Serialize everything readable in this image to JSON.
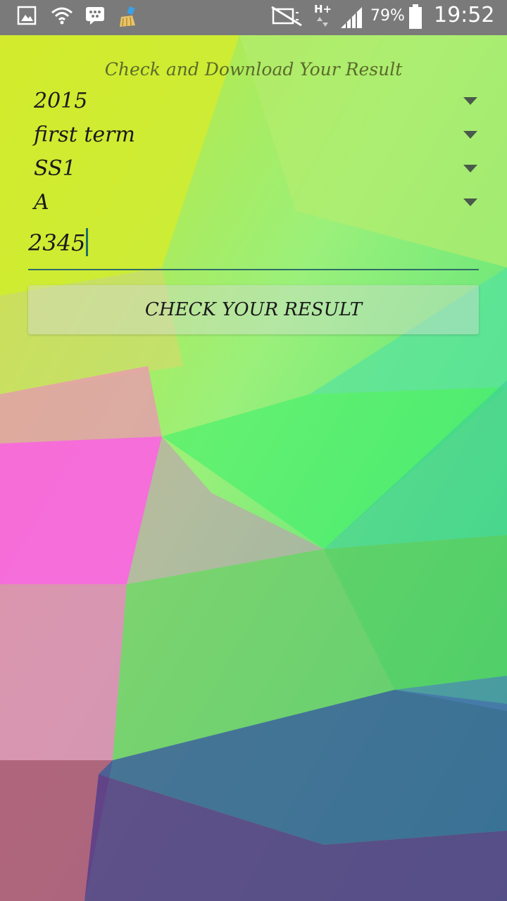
{
  "status_bar": {
    "battery": "79%",
    "time": "19:52",
    "network": "H+",
    "icons": [
      "gallery-icon",
      "wifi-icon",
      "bbm-icon",
      "cleaner-icon",
      "mute-icon",
      "network-icon",
      "signal-icon",
      "battery-icon"
    ]
  },
  "form": {
    "title": "Check and Download Your Result",
    "spinners": [
      {
        "value": "2015"
      },
      {
        "value": "first term"
      },
      {
        "value": "SS1"
      },
      {
        "value": "A"
      }
    ],
    "pin_input": {
      "value": "2345"
    },
    "submit_label": "CHECK YOUR RESULT"
  },
  "colors": {
    "status_bar": "#7a7a7a",
    "underline": "#2f6e6a",
    "title": "#5b6b2a"
  }
}
